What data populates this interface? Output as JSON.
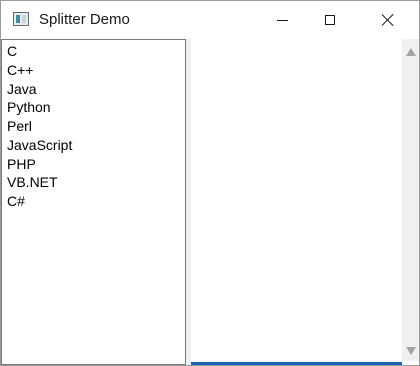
{
  "window": {
    "title": "Splitter Demo",
    "app_icon": "splitter-app-icon",
    "controls": {
      "minimize_icon": "minimize-icon",
      "maximize_icon": "maximize-icon",
      "close_icon": "close-icon"
    }
  },
  "left_pane": {
    "items": [
      {
        "label": "C"
      },
      {
        "label": "C++"
      },
      {
        "label": "Java"
      },
      {
        "label": "Python"
      },
      {
        "label": "Perl"
      },
      {
        "label": "JavaScript"
      },
      {
        "label": "PHP"
      },
      {
        "label": "VB.NET"
      },
      {
        "label": "C#"
      }
    ]
  },
  "right_pane": {
    "text": "",
    "scrollbar": {
      "up_icon": "scroll-up-arrow-icon",
      "down_icon": "scroll-down-arrow-icon"
    }
  },
  "colors": {
    "focus_accent": "#1664b4",
    "title_bar": "#ffffff",
    "window_background": "#f0f0f0"
  }
}
